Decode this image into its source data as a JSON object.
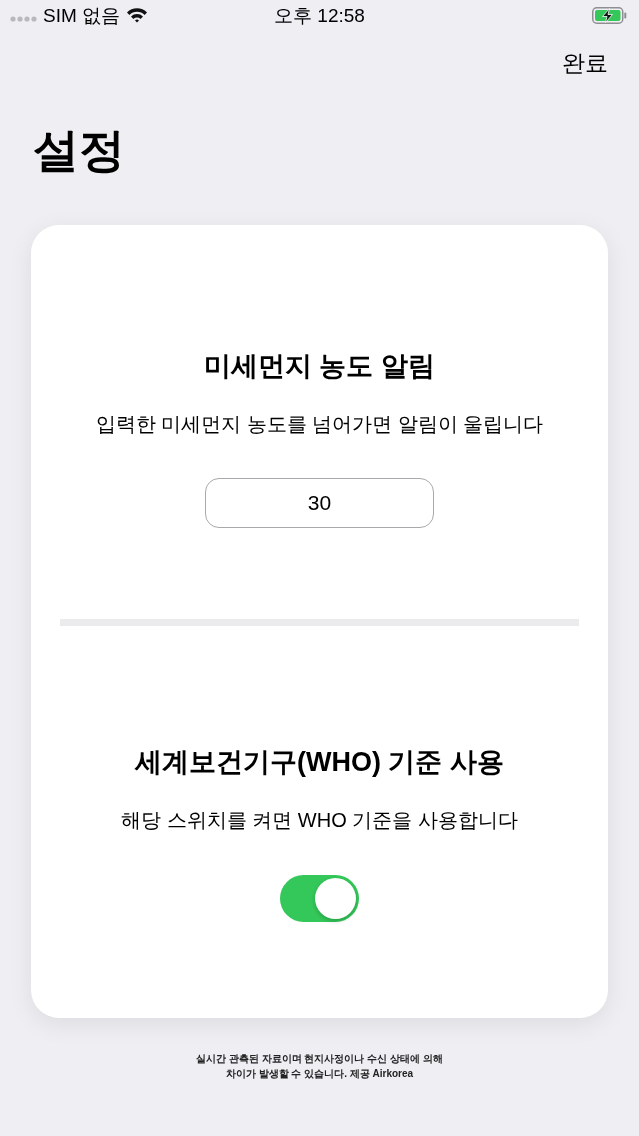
{
  "status_bar": {
    "carrier": "SIM 없음",
    "time": "오후 12:58",
    "charging": true
  },
  "nav": {
    "done_button": "완료"
  },
  "title": "설정",
  "sections": [
    {
      "kind": "input",
      "title": "미세먼지 농도 알림",
      "description": "입력한 미세먼지 농도를 넘어가면 알림이 울립니다",
      "value": "30"
    },
    {
      "kind": "switch",
      "title": "세계보건기구(WHO) 기준 사용",
      "description": "해당 스위치를 켜면 WHO 기준을 사용합니다",
      "on": true
    }
  ],
  "footer": "실시간 관측된 자료이며 현지사정이나 수신 상태에 의해\n차이가 발생할 수 있습니다. 제공 Airkorea"
}
